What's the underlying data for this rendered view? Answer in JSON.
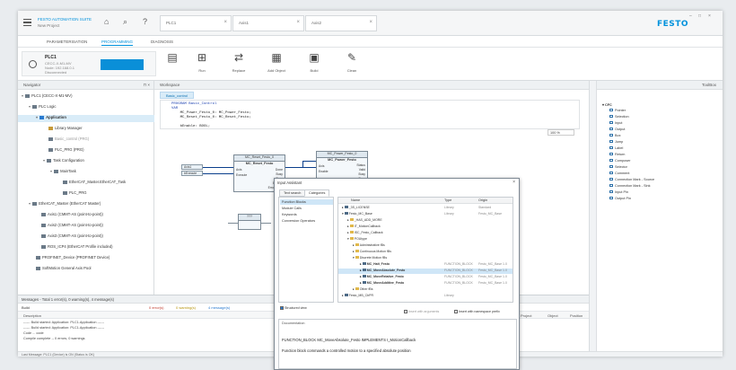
{
  "app": {
    "suite": "FESTO AUTOMATION SUITE",
    "project": "New Project",
    "brand": "FESTO",
    "accent": "#0091dc"
  },
  "doc_tabs": [
    "PLC1",
    "Axis1",
    "Axis2"
  ],
  "subtabs": [
    "PARAMETERISATION",
    "PROGRAMMING",
    "DIAGNOSIS"
  ],
  "plc": {
    "name": "PLC1",
    "line1": "CECC-X-M1-MV",
    "line2": "Node: 192.168.0.1",
    "line3": "Disconnected"
  },
  "ribbon": [
    "Run",
    "Replace",
    "Add Object",
    "Build",
    "Clean"
  ],
  "navigator": {
    "title": "Navigator",
    "items": [
      "PLC1 (CECC-X-M1-MV)",
      "PLC Logic",
      "Application",
      "Library Manager",
      "Basic_control (PRG)",
      "PLC_PRG (PRG)",
      "Task Configuration",
      "MainTask",
      "EtherCAT_Master.EtherCAT_Task",
      "PLC_PRG",
      "EtherCAT_Master (EtherCAT Master)",
      "Axis1 (CMMT-AS (point-to-point))",
      "Axis2 (CMMT-AS (point-to-point))",
      "Axis3 (CMMT-AS (point-to-point))",
      "ROS_ICP4 (EtherCAT Profile included)",
      "PROFINET_Device (PROFINET Device)",
      "SoftMotion General Axis Pool"
    ]
  },
  "workspace": {
    "title": "Workspace",
    "tab": "Basic_control",
    "code": [
      "PROGRAM Basic_Control",
      "VAR",
      "    MC_Power_Festo_0: MC_Power_Festo;",
      "    MC_Reset_Festo_0: MC_Reset_Festo;",
      "",
      "    bEnable: BOOL;"
    ],
    "zoom": "100 %",
    "fb1": {
      "inst": "MC_Reset_Festo_0",
      "type": "MC_Reset_Festo",
      "inputs": [
        "Axis",
        "Execute"
      ],
      "outputs": [
        "Done",
        "Busy",
        "Error",
        "ErrorID",
        "ErrorString"
      ]
    },
    "fb2": {
      "inst": "MC_Power_Festo_0",
      "type": "MC_Power_Festo",
      "inputs": [
        "Axis",
        "Enable"
      ],
      "outputs": [
        "Status",
        "Valid",
        "Busy",
        "Error",
        "ErrorID",
        "ErrorString"
      ]
    },
    "var_axis": "Axis1",
    "var_exec": "bExecute",
    "fb_small": "???"
  },
  "toolbox": {
    "title": "ToolBox",
    "items": [
      "CFC",
      "Pointer",
      "Selection",
      "Input",
      "Output",
      "Box",
      "Jump",
      "Label",
      "Return",
      "Composer",
      "Selector",
      "Comment",
      "Connection Mark - Source",
      "Connection Mark - Sink",
      "Input Pin",
      "Output Pin"
    ]
  },
  "messages": {
    "title": "Messages - Total 1 error(s), 0 warning(s), 4 message(s)",
    "filter": "Build",
    "errors": "0 error(s)",
    "warnings": "0 warning(s)",
    "msgs": "4 message(s)",
    "cols": [
      "Description",
      "Project",
      "Object",
      "Position"
    ],
    "lines": [
      "------ Build started: Application: PLC1.Application ------",
      "------ Build started: Application: PLC1.Application ------",
      "Code ... code",
      "Compile complete -- 0 errors, 0 warnings"
    ]
  },
  "status_bar": "Last Message: PLC1 (Device) is ON (Status is OK)",
  "dialog": {
    "title": "Input Assistant",
    "tabs": [
      "Text search",
      "Categories"
    ],
    "categories": [
      "Function Blocks",
      "Module Calls",
      "Keywords",
      "Conversion Operators"
    ],
    "cols": [
      "Name",
      "Type",
      "Origin"
    ],
    "rows": [
      {
        "name": "_3S_LICENSE",
        "type": "Library",
        "origin": "Standard"
      },
      {
        "name": "Festo_MC_Base",
        "type": "Library",
        "origin": "Festo_MC_Base"
      },
      {
        "name": "_HAS_ADD_MORE",
        "type": "",
        "origin": ""
      },
      {
        "name": "IT_MotionCallback",
        "type": "",
        "origin": ""
      },
      {
        "name": "ISC_Festo_Callback",
        "type": "",
        "origin": ""
      },
      {
        "name": "POUtype",
        "type": "",
        "origin": ""
      },
      {
        "name": "Administrative fBs",
        "type": "",
        "origin": ""
      },
      {
        "name": "Continuous Motion fBs",
        "type": "",
        "origin": ""
      },
      {
        "name": "Discrete Motion fBs",
        "type": "",
        "origin": ""
      },
      {
        "name": "MC_Halt_Festo",
        "type": "FUNCTION_BLOCK",
        "origin": "Festo_MC_Base 1.0"
      },
      {
        "name": "MC_MoveAbsolute_Festo",
        "type": "FUNCTION_BLOCK",
        "origin": "Festo_MC_Base 1.0"
      },
      {
        "name": "MC_MoveRelative_Festo",
        "type": "FUNCTION_BLOCK",
        "origin": "Festo_MC_Base 1.0"
      },
      {
        "name": "MC_MoveAdditive_Festo",
        "type": "FUNCTION_BLOCK",
        "origin": "Festo_MC_Base 1.0"
      },
      {
        "name": "Other fBs",
        "type": "",
        "origin": ""
      },
      {
        "name": "Festo_MB_CbPR",
        "type": "Library",
        "origin": ""
      }
    ],
    "structured_view": "Structured view",
    "insert_args": "Insert with arguments",
    "insert_ns": "Insert with namespace prefix",
    "documentation": "Documentation",
    "doc_line1": "FUNCTION_BLOCK MC_MoveAbsolute_Festo IMPLEMENTS I_MotionCallback",
    "doc_line2": "Function block commands a controlled motion to a specified absolute position"
  }
}
